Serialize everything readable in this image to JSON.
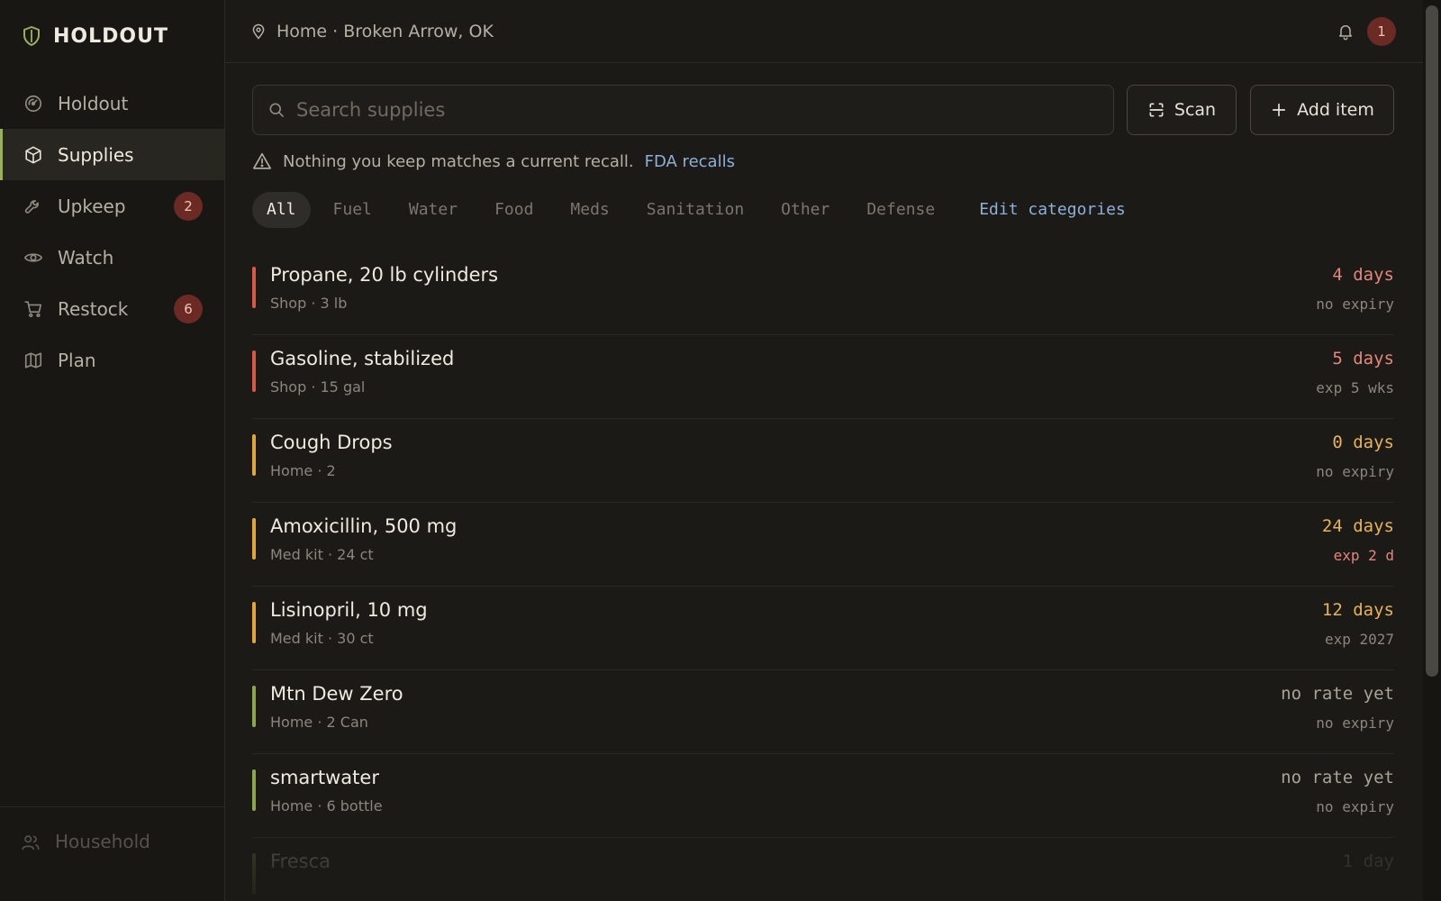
{
  "app": {
    "brand": "HOLDOUT"
  },
  "colors": {
    "accent": "#9bb05d",
    "critical": "#d9584a",
    "warning": "#e0a638",
    "ok": "#8aa64e",
    "link": "#8fb0d6",
    "badge_bg": "#6b2a23"
  },
  "sidebar": {
    "items": [
      {
        "label": "Holdout",
        "icon": "gauge-icon",
        "badge": ""
      },
      {
        "label": "Supplies",
        "icon": "box-icon",
        "badge": ""
      },
      {
        "label": "Upkeep",
        "icon": "wrench-icon",
        "badge": "2"
      },
      {
        "label": "Watch",
        "icon": "eye-icon",
        "badge": ""
      },
      {
        "label": "Restock",
        "icon": "cart-icon",
        "badge": "6"
      },
      {
        "label": "Plan",
        "icon": "map-icon",
        "badge": ""
      }
    ],
    "active": "Supplies",
    "footer": {
      "label": "Household",
      "icon": "users-icon"
    }
  },
  "header": {
    "location": "Home · Broken Arrow, OK",
    "notifications_count": "1"
  },
  "search": {
    "placeholder": "Search supplies",
    "value": ""
  },
  "actions": {
    "scan_label": "Scan",
    "add_label": "Add item"
  },
  "recall": {
    "message": "Nothing you keep matches a current recall.",
    "link_label": "FDA recalls"
  },
  "filters": {
    "tabs": [
      "All",
      "Fuel",
      "Water",
      "Food",
      "Meds",
      "Sanitation",
      "Other",
      "Defense"
    ],
    "active": "All",
    "edit_label": "Edit categories"
  },
  "supplies": [
    {
      "name": "Propane, 20 lb cylinders",
      "meta": "Shop · 3 lb",
      "days": "4 days",
      "expiry": "no expiry",
      "level": "critical",
      "days_color": "#e4867a",
      "expiry_color": "#8b867d"
    },
    {
      "name": "Gasoline, stabilized",
      "meta": "Shop · 15 gal",
      "days": "5 days",
      "expiry": "exp 5 wks",
      "level": "critical",
      "days_color": "#e4867a",
      "expiry_color": "#8b867d"
    },
    {
      "name": "Cough Drops",
      "meta": "Home · 2",
      "days": "0 days",
      "expiry": "no expiry",
      "level": "warning",
      "days_color": "#e6b25a",
      "expiry_color": "#8b867d"
    },
    {
      "name": "Amoxicillin, 500 mg",
      "meta": "Med kit · 24 ct",
      "days": "24 days",
      "expiry": "exp 2 d",
      "level": "warning",
      "days_color": "#e6b25a",
      "expiry_color": "#e4867a"
    },
    {
      "name": "Lisinopril, 10 mg",
      "meta": "Med kit · 30 ct",
      "days": "12 days",
      "expiry": "exp 2027",
      "level": "warning",
      "days_color": "#e6b25a",
      "expiry_color": "#8b867d"
    },
    {
      "name": "Mtn Dew Zero",
      "meta": "Home · 2 Can",
      "days": "no rate yet",
      "expiry": "no expiry",
      "level": "ok",
      "days_color": "#a9a397",
      "expiry_color": "#8b867d"
    },
    {
      "name": "smartwater",
      "meta": "Home · 6 bottle",
      "days": "no rate yet",
      "expiry": "no expiry",
      "level": "ok",
      "days_color": "#a9a397",
      "expiry_color": "#8b867d"
    },
    {
      "name": "Fresca",
      "meta": "",
      "days": "1 day",
      "expiry": "",
      "level": "ok",
      "days_color": "#a9a397",
      "expiry_color": "#8b867d"
    }
  ]
}
